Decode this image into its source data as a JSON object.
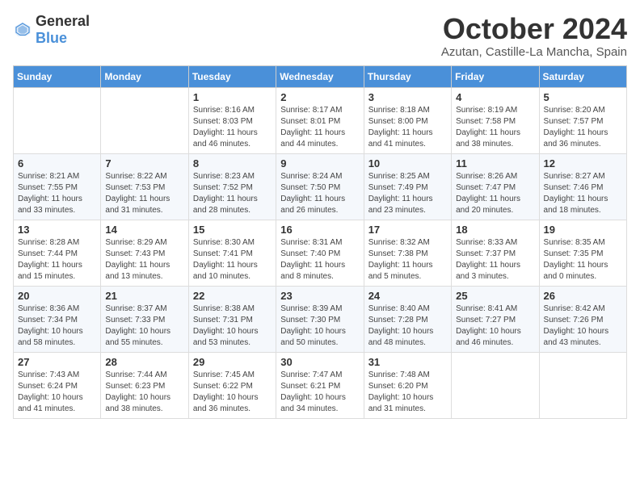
{
  "header": {
    "logo_general": "General",
    "logo_blue": "Blue",
    "month_title": "October 2024",
    "location": "Azutan, Castille-La Mancha, Spain"
  },
  "days_of_week": [
    "Sunday",
    "Monday",
    "Tuesday",
    "Wednesday",
    "Thursday",
    "Friday",
    "Saturday"
  ],
  "weeks": [
    [
      {
        "day": "",
        "text": ""
      },
      {
        "day": "",
        "text": ""
      },
      {
        "day": "1",
        "text": "Sunrise: 8:16 AM\nSunset: 8:03 PM\nDaylight: 11 hours and 46 minutes."
      },
      {
        "day": "2",
        "text": "Sunrise: 8:17 AM\nSunset: 8:01 PM\nDaylight: 11 hours and 44 minutes."
      },
      {
        "day": "3",
        "text": "Sunrise: 8:18 AM\nSunset: 8:00 PM\nDaylight: 11 hours and 41 minutes."
      },
      {
        "day": "4",
        "text": "Sunrise: 8:19 AM\nSunset: 7:58 PM\nDaylight: 11 hours and 38 minutes."
      },
      {
        "day": "5",
        "text": "Sunrise: 8:20 AM\nSunset: 7:57 PM\nDaylight: 11 hours and 36 minutes."
      }
    ],
    [
      {
        "day": "6",
        "text": "Sunrise: 8:21 AM\nSunset: 7:55 PM\nDaylight: 11 hours and 33 minutes."
      },
      {
        "day": "7",
        "text": "Sunrise: 8:22 AM\nSunset: 7:53 PM\nDaylight: 11 hours and 31 minutes."
      },
      {
        "day": "8",
        "text": "Sunrise: 8:23 AM\nSunset: 7:52 PM\nDaylight: 11 hours and 28 minutes."
      },
      {
        "day": "9",
        "text": "Sunrise: 8:24 AM\nSunset: 7:50 PM\nDaylight: 11 hours and 26 minutes."
      },
      {
        "day": "10",
        "text": "Sunrise: 8:25 AM\nSunset: 7:49 PM\nDaylight: 11 hours and 23 minutes."
      },
      {
        "day": "11",
        "text": "Sunrise: 8:26 AM\nSunset: 7:47 PM\nDaylight: 11 hours and 20 minutes."
      },
      {
        "day": "12",
        "text": "Sunrise: 8:27 AM\nSunset: 7:46 PM\nDaylight: 11 hours and 18 minutes."
      }
    ],
    [
      {
        "day": "13",
        "text": "Sunrise: 8:28 AM\nSunset: 7:44 PM\nDaylight: 11 hours and 15 minutes."
      },
      {
        "day": "14",
        "text": "Sunrise: 8:29 AM\nSunset: 7:43 PM\nDaylight: 11 hours and 13 minutes."
      },
      {
        "day": "15",
        "text": "Sunrise: 8:30 AM\nSunset: 7:41 PM\nDaylight: 11 hours and 10 minutes."
      },
      {
        "day": "16",
        "text": "Sunrise: 8:31 AM\nSunset: 7:40 PM\nDaylight: 11 hours and 8 minutes."
      },
      {
        "day": "17",
        "text": "Sunrise: 8:32 AM\nSunset: 7:38 PM\nDaylight: 11 hours and 5 minutes."
      },
      {
        "day": "18",
        "text": "Sunrise: 8:33 AM\nSunset: 7:37 PM\nDaylight: 11 hours and 3 minutes."
      },
      {
        "day": "19",
        "text": "Sunrise: 8:35 AM\nSunset: 7:35 PM\nDaylight: 11 hours and 0 minutes."
      }
    ],
    [
      {
        "day": "20",
        "text": "Sunrise: 8:36 AM\nSunset: 7:34 PM\nDaylight: 10 hours and 58 minutes."
      },
      {
        "day": "21",
        "text": "Sunrise: 8:37 AM\nSunset: 7:33 PM\nDaylight: 10 hours and 55 minutes."
      },
      {
        "day": "22",
        "text": "Sunrise: 8:38 AM\nSunset: 7:31 PM\nDaylight: 10 hours and 53 minutes."
      },
      {
        "day": "23",
        "text": "Sunrise: 8:39 AM\nSunset: 7:30 PM\nDaylight: 10 hours and 50 minutes."
      },
      {
        "day": "24",
        "text": "Sunrise: 8:40 AM\nSunset: 7:28 PM\nDaylight: 10 hours and 48 minutes."
      },
      {
        "day": "25",
        "text": "Sunrise: 8:41 AM\nSunset: 7:27 PM\nDaylight: 10 hours and 46 minutes."
      },
      {
        "day": "26",
        "text": "Sunrise: 8:42 AM\nSunset: 7:26 PM\nDaylight: 10 hours and 43 minutes."
      }
    ],
    [
      {
        "day": "27",
        "text": "Sunrise: 7:43 AM\nSunset: 6:24 PM\nDaylight: 10 hours and 41 minutes."
      },
      {
        "day": "28",
        "text": "Sunrise: 7:44 AM\nSunset: 6:23 PM\nDaylight: 10 hours and 38 minutes."
      },
      {
        "day": "29",
        "text": "Sunrise: 7:45 AM\nSunset: 6:22 PM\nDaylight: 10 hours and 36 minutes."
      },
      {
        "day": "30",
        "text": "Sunrise: 7:47 AM\nSunset: 6:21 PM\nDaylight: 10 hours and 34 minutes."
      },
      {
        "day": "31",
        "text": "Sunrise: 7:48 AM\nSunset: 6:20 PM\nDaylight: 10 hours and 31 minutes."
      },
      {
        "day": "",
        "text": ""
      },
      {
        "day": "",
        "text": ""
      }
    ]
  ]
}
